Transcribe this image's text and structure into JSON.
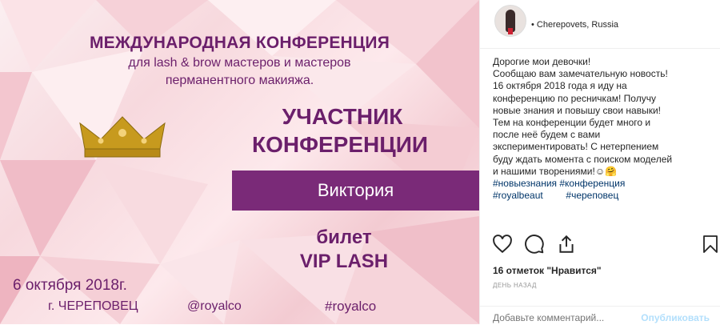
{
  "image": {
    "title": "МЕЖДУНАРОДНАЯ КОНФЕРЕНЦИЯ",
    "subtitle_line1": "для lash & brow мастеров и мастеров",
    "subtitle_line2": "перманентного макияжа.",
    "participant_line1": "УЧАСТНИК",
    "participant_line2": "КОНФЕРЕНЦИИ",
    "name": "Виктория",
    "ticket_line1": "билет",
    "ticket_line2": "VIP LASH",
    "date": "6 октября 2018г.",
    "city": "г. ЧЕРЕПОВЕЦ",
    "handle": "@royalco",
    "hashtag": "#royalco",
    "colors": {
      "purple": "#6b1f6b",
      "bar": "#7a2a78",
      "gold": "#c79a1e"
    }
  },
  "post": {
    "location": "• Cherepovets, Russia",
    "caption_lines": [
      "Дорогие мои девочки!",
      "Сообщаю вам замечательную новость!",
      "16 октября 2018 года я иду на",
      "конференцию по ресничкам! Получу",
      "новые знания и повышу свои навыки!",
      "Тем на конференции будет много и",
      "после неё будем с вами",
      "экспериментировать! С нетерпением",
      "буду ждать момента с поиском моделей",
      "и нашими творениями!☺🤗"
    ],
    "hashtags": {
      "h1": "#новыезнания",
      "h2": "#конференция",
      "h3": "#royalbeaut",
      "h4": "#череповец"
    },
    "likes": "16 отметок \"Нравится\"",
    "time": "ДЕНЬ НАЗАД",
    "comment_placeholder": "Добавьте комментарий...",
    "post_label": "Опубликовать",
    "icons": [
      "heart-icon",
      "comment-icon",
      "share-icon",
      "bookmark-icon"
    ]
  }
}
